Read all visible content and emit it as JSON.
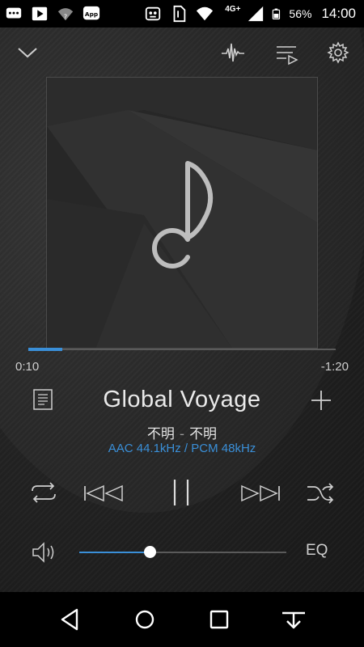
{
  "status_bar": {
    "icons_left": [
      "chat-bubble-icon",
      "play-store-icon",
      "wifi-question-icon",
      "app-icon"
    ],
    "app_badge": "App",
    "icons_mid": [
      "robot-icon",
      "sim-icon",
      "wifi-icon"
    ],
    "network": "4G+",
    "battery_pct": "56%",
    "time": "14:00"
  },
  "toolbar": {
    "collapse_icon": "chevron-down-icon",
    "visualizer_icon": "waveform-icon",
    "queue_icon": "playlist-icon",
    "settings_icon": "gear-icon"
  },
  "artwork": {
    "placeholder_icon": "music-note-icon"
  },
  "playback": {
    "elapsed": "0:10",
    "remaining": "-1:20",
    "progress": 0.11
  },
  "track": {
    "title": "Global Voyage",
    "artist": "不明",
    "separator": "-",
    "album": "不明",
    "format": "AAC 44.1kHz / PCM 48kHz"
  },
  "controls": {
    "repeat_icon": "repeat-icon",
    "previous_icon": "skip-previous-icon",
    "play_pause_icon": "pause-icon",
    "next_icon": "skip-next-icon",
    "shuffle_icon": "shuffle-icon",
    "lyrics_icon": "lyrics-document-icon",
    "add_icon": "plus-icon"
  },
  "volume": {
    "level": 0.34,
    "eq_label": "EQ"
  },
  "colors": {
    "accent": "#3a8fd8",
    "format_text": "#3a8fd8",
    "background": "#222222"
  },
  "navbar": {
    "back_icon": "back-triangle-icon",
    "home_icon": "home-circle-icon",
    "recents_icon": "recents-square-icon",
    "hide_icon": "hide-keyboard-icon"
  }
}
